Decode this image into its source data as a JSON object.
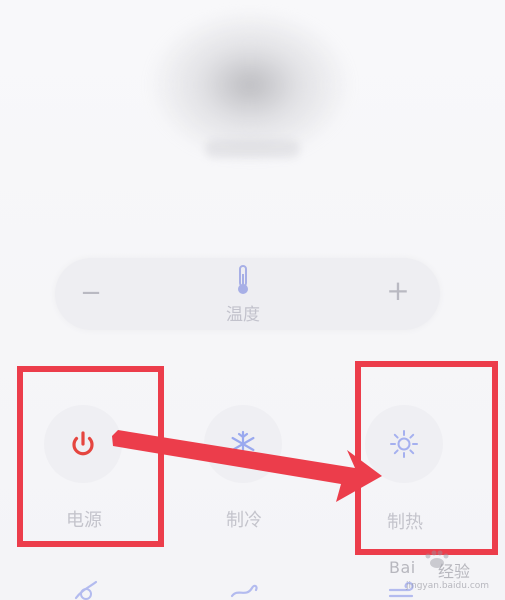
{
  "temperature": {
    "minus_label": "−",
    "plus_label": "+",
    "label": "温度"
  },
  "modes": [
    {
      "label": "电源",
      "icon": "power-icon",
      "color": "#e5453f"
    },
    {
      "label": "制冷",
      "icon": "snowflake-icon",
      "color": "#9aa9ef"
    },
    {
      "label": "制热",
      "icon": "sun-icon",
      "color": "#a5b0ef"
    }
  ],
  "bottom_icons": [
    "fan-icon",
    "wind-icon",
    "wind-speed-icon"
  ],
  "annotation": {
    "box_color": "#ec3d4b",
    "arrow_color": "#ec3d4b"
  },
  "watermark": {
    "brand": "Bai",
    "suffix": "经验",
    "url": "jingyan.baidu.com"
  }
}
